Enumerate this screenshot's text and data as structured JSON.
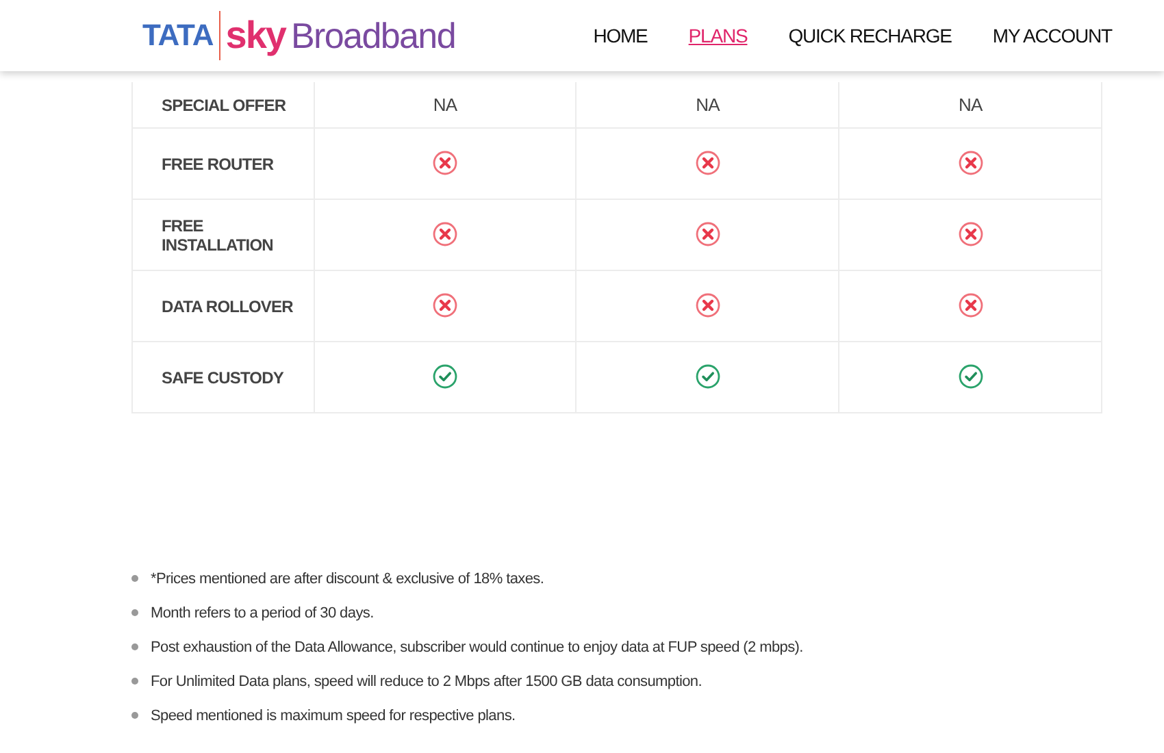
{
  "logo": {
    "brand": "TATA",
    "sub": "sky",
    "product": "Broadband"
  },
  "nav": [
    {
      "label": "HOME",
      "selected": false
    },
    {
      "label": "PLANS",
      "selected": true
    },
    {
      "label": "QUICK RECHARGE",
      "selected": false
    },
    {
      "label": "MY ACCOUNT",
      "selected": false
    }
  ],
  "table": {
    "rows": [
      {
        "label": "SPECIAL OFFER",
        "cells": [
          {
            "kind": "text",
            "value": "NA"
          },
          {
            "kind": "text",
            "value": "NA"
          },
          {
            "kind": "text",
            "value": "NA"
          }
        ]
      },
      {
        "label": "FREE ROUTER",
        "cells": [
          {
            "kind": "cross"
          },
          {
            "kind": "cross"
          },
          {
            "kind": "cross"
          }
        ]
      },
      {
        "label": "FREE INSTALLATION",
        "cells": [
          {
            "kind": "cross"
          },
          {
            "kind": "cross"
          },
          {
            "kind": "cross"
          }
        ]
      },
      {
        "label": "DATA ROLLOVER",
        "cells": [
          {
            "kind": "cross"
          },
          {
            "kind": "cross"
          },
          {
            "kind": "cross"
          }
        ]
      },
      {
        "label": "SAFE CUSTODY",
        "cells": [
          {
            "kind": "check"
          },
          {
            "kind": "check"
          },
          {
            "kind": "check"
          }
        ]
      }
    ]
  },
  "notes": [
    "*Prices mentioned are after discount & exclusive of 18% taxes.",
    "Month refers to a period of 30 days.",
    "Post exhaustion of the Data Allowance, subscriber would continue to enjoy data at FUP speed (2 mbps).",
    "For Unlimited Data plans, speed will reduce to 2 Mbps after 1500 GB data consumption.",
    "Speed mentioned is maximum speed for respective plans."
  ]
}
